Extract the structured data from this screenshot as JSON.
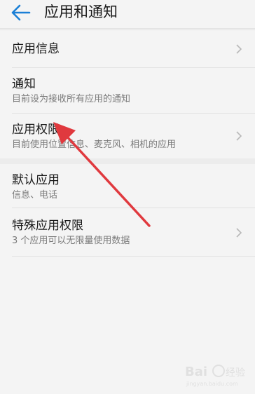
{
  "header": {
    "title": "应用和通知"
  },
  "items": [
    {
      "label": "应用信息",
      "sub": ""
    },
    {
      "label": "通知",
      "sub": "目前设为接收所有应用的通知"
    },
    {
      "label": "应用权限",
      "sub": "目前使用位置信息、麦克风、相机的应用"
    },
    {
      "label": "默认应用",
      "sub": "信息、电话"
    },
    {
      "label": "特殊应用权限",
      "sub": "3 个应用可以无限量使用数据"
    }
  ],
  "icons": {
    "back": "back-arrow-icon",
    "chevron": "chevron-right-icon"
  },
  "colors": {
    "accent": "#1a7fd6",
    "annotation_arrow": "#e0393e"
  }
}
